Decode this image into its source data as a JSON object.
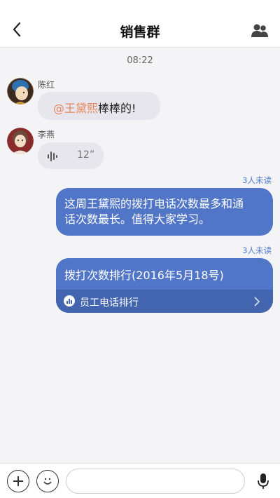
{
  "header": {
    "title": "销售群"
  },
  "timestamp": "08:22",
  "messages": {
    "m1": {
      "sender": "陈红",
      "mention": "@王黛熙",
      "text": "棒棒的!"
    },
    "m2": {
      "sender": "李燕",
      "duration": "12”"
    },
    "m3": {
      "read_status": "3人未读",
      "line1": "这周王黛熙的拨打电话次数最多和通",
      "line2": "话次数最长。值得大家学习。"
    },
    "m4": {
      "read_status": "3人未读",
      "title": "拨打次数排行(2016年5月18号)",
      "link_label": "员工电话排行"
    }
  },
  "input": {
    "placeholder": ""
  },
  "colors": {
    "accent": "#5176c8",
    "mention": "#e9855a",
    "read_status": "#4f7acd"
  },
  "icons": {
    "back": "chevron-left-icon",
    "members": "group-members-icon",
    "voice": "voice-wave-icon",
    "chart": "bar-chart-icon",
    "link": "chevron-right-icon",
    "add": "plus-icon",
    "emoji": "smiley-icon",
    "mic": "microphone-icon"
  }
}
